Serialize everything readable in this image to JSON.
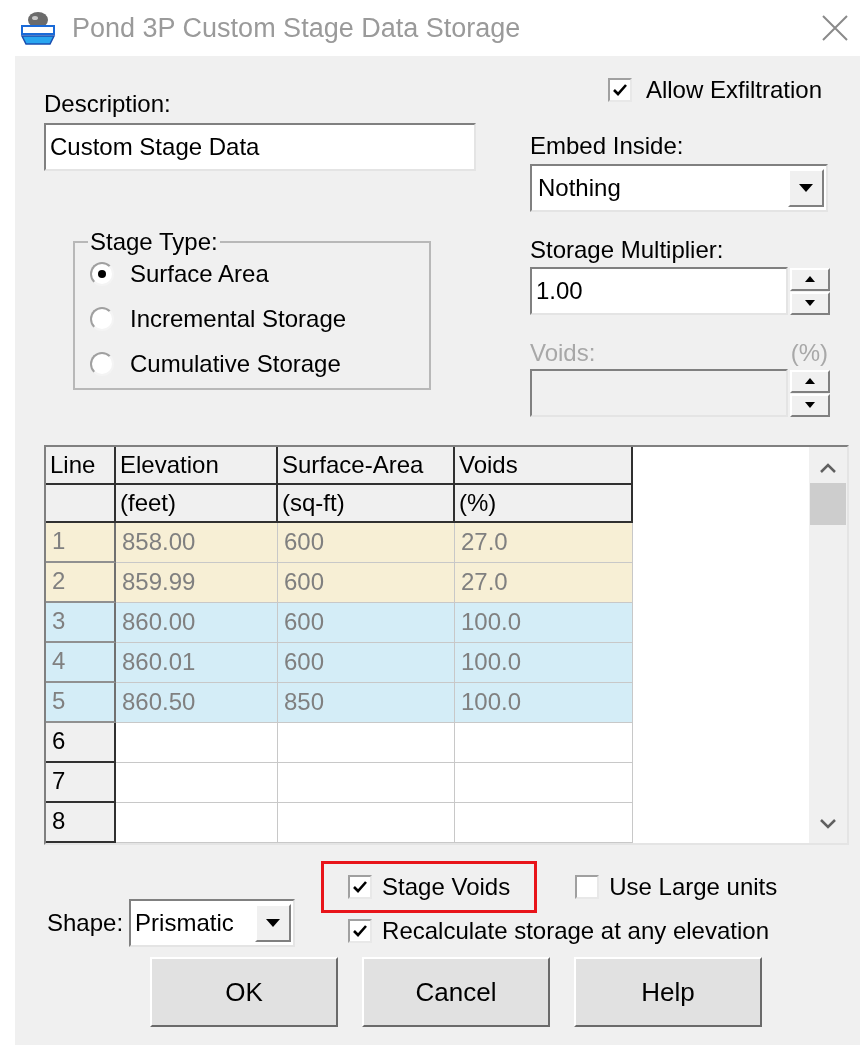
{
  "window": {
    "title": "Pond 3P Custom Stage Data Storage"
  },
  "description": {
    "label": "Description:",
    "value": "Custom Stage Data"
  },
  "allow_exfiltration": {
    "label": "Allow Exfiltration",
    "checked": true
  },
  "embed_inside": {
    "label": "Embed Inside:",
    "value": "Nothing"
  },
  "stage_type": {
    "label": "Stage Type:",
    "options": [
      {
        "label": "Surface Area",
        "selected": true
      },
      {
        "label": "Incremental Storage",
        "selected": false
      },
      {
        "label": "Cumulative Storage",
        "selected": false
      }
    ]
  },
  "storage_multiplier": {
    "label": "Storage Multiplier:",
    "value": "1.00"
  },
  "voids": {
    "label": "Voids:",
    "unit": "(%)",
    "disabled": true
  },
  "table": {
    "columns": [
      {
        "title": "Line"
      },
      {
        "title": "Elevation",
        "unit": "(feet)"
      },
      {
        "title": "Surface-Area",
        "unit": "(sq-ft)"
      },
      {
        "title": "Voids",
        "unit": "(%)"
      }
    ],
    "rows": [
      {
        "line": "1",
        "elevation": "858.00",
        "surface_area": "600",
        "voids": "27.0",
        "color": "#f7efd5"
      },
      {
        "line": "2",
        "elevation": "859.99",
        "surface_area": "600",
        "voids": "27.0",
        "color": "#f7efd5"
      },
      {
        "line": "3",
        "elevation": "860.00",
        "surface_area": "600",
        "voids": "100.0",
        "color": "#d4edf7"
      },
      {
        "line": "4",
        "elevation": "860.01",
        "surface_area": "600",
        "voids": "100.0",
        "color": "#d4edf7"
      },
      {
        "line": "5",
        "elevation": "860.50",
        "surface_area": "850",
        "voids": "100.0",
        "color": "#d4edf7"
      },
      {
        "line": "6"
      },
      {
        "line": "7"
      },
      {
        "line": "8"
      }
    ]
  },
  "shape": {
    "label": "Shape:",
    "value": "Prismatic"
  },
  "options": [
    {
      "label": "Stage Voids",
      "checked": true,
      "highlighted": true
    },
    {
      "label": "Use Large units",
      "checked": false,
      "highlighted": false
    },
    {
      "label": "Recalculate storage at any elevation",
      "checked": true,
      "highlighted": false
    }
  ],
  "buttons": [
    "OK",
    "Cancel",
    "Help"
  ]
}
